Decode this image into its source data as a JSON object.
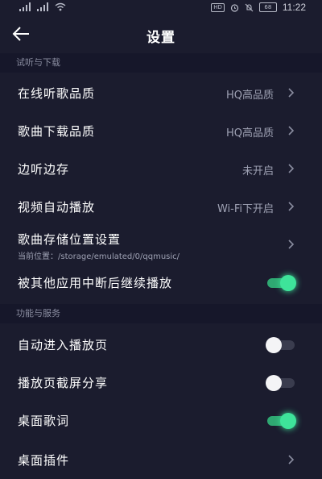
{
  "status_bar": {
    "hd_label": "HD",
    "battery": "68",
    "time": "11:22"
  },
  "header": {
    "title": "设置"
  },
  "sections": [
    {
      "title": "试听与下载",
      "items": [
        {
          "label": "在线听歌品质",
          "value": "HQ高品质"
        },
        {
          "label": "歌曲下载品质",
          "value": "HQ高品质"
        },
        {
          "label": "边听边存",
          "value": "未开启"
        },
        {
          "label": "视频自动播放",
          "value": "Wi-Fi下开启"
        },
        {
          "label": "歌曲存储位置设置",
          "sub": "当前位置：/storage/emulated/0/qqmusic/"
        },
        {
          "label": "被其他应用中断后继续播放",
          "toggle": true
        }
      ]
    },
    {
      "title": "功能与服务",
      "items": [
        {
          "label": "自动进入播放页",
          "toggle": false
        },
        {
          "label": "播放页截屏分享",
          "toggle": false
        },
        {
          "label": "桌面歌词",
          "toggle": true
        },
        {
          "label": "桌面插件"
        }
      ]
    }
  ],
  "colors": {
    "background": "#1b1c2e",
    "section_background": "#16172a",
    "toggle_on": "#3ee39a",
    "secondary_text": "#9ea1b3"
  },
  "icons": {
    "back": "arrow-left-icon",
    "chevron": "chevron-right-icon"
  }
}
